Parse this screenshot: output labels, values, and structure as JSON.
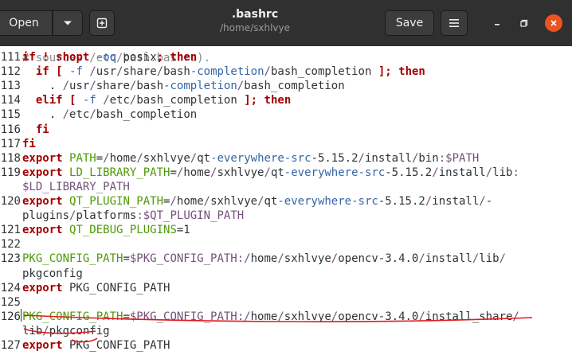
{
  "header": {
    "open_label": "Open",
    "title": ".bashrc",
    "subtitle": "/home/sxhlvye",
    "save_label": "Save",
    "icons": [
      "chevron-down-icon",
      "new-document-icon",
      "hamburger-menu-icon",
      "minimize-icon",
      "maximize-icon",
      "close-icon"
    ],
    "colors": {
      "headerbar": "#303030",
      "close": "#e95420"
    }
  },
  "editor": {
    "top_fragment": "# sources /etc/bash.bashrc).",
    "lines": [
      {
        "num": "111",
        "text": "if ! shopt -oq posix; then"
      },
      {
        "num": "112",
        "text": "  if [ -f /usr/share/bash-completion/bash_completion ]; then"
      },
      {
        "num": "113",
        "text": "    . /usr/share/bash-completion/bash_completion"
      },
      {
        "num": "114",
        "text": "  elif [ -f /etc/bash_completion ]; then"
      },
      {
        "num": "115",
        "text": "    . /etc/bash_completion"
      },
      {
        "num": "116",
        "text": "  fi"
      },
      {
        "num": "117",
        "text": "fi"
      },
      {
        "num": "118",
        "text": "export PATH=/home/sxhlvye/qt-everywhere-src-5.15.2/install/bin:$PATH"
      },
      {
        "num": "119",
        "text": "export LD_LIBRARY_PATH=/home/sxhlvye/qt-everywhere-src-5.15.2/install/lib:"
      },
      {
        "num": "",
        "text": "$LD_LIBRARY_PATH"
      },
      {
        "num": "120",
        "text": "export QT_PLUGIN_PATH=/home/sxhlvye/qt-everywhere-src-5.15.2/install/-"
      },
      {
        "num": "",
        "text": "plugins/platforms:$QT_PLUGIN_PATH"
      },
      {
        "num": "121",
        "text": "export QT_DEBUG_PLUGINS=1"
      },
      {
        "num": "122",
        "text": ""
      },
      {
        "num": "123",
        "text": "PKG_CONFIG_PATH=$PKG_CONFIG_PATH:/home/sxhlvye/opencv-3.4.0/install/lib/"
      },
      {
        "num": "",
        "text": "pkgconfig"
      },
      {
        "num": "124",
        "text": "export PKG_CONFIG_PATH"
      },
      {
        "num": "125",
        "text": ""
      },
      {
        "num": "126",
        "text": "PKG_CONFIG_PATH=$PKG_CONFIG_PATH:/home/sxhlvye/opencv-3.4.0/install_share/"
      },
      {
        "num": "",
        "text": "lib/pkgconfig"
      },
      {
        "num": "127",
        "text": "export PKG_CONFIG_PATH"
      }
    ]
  }
}
